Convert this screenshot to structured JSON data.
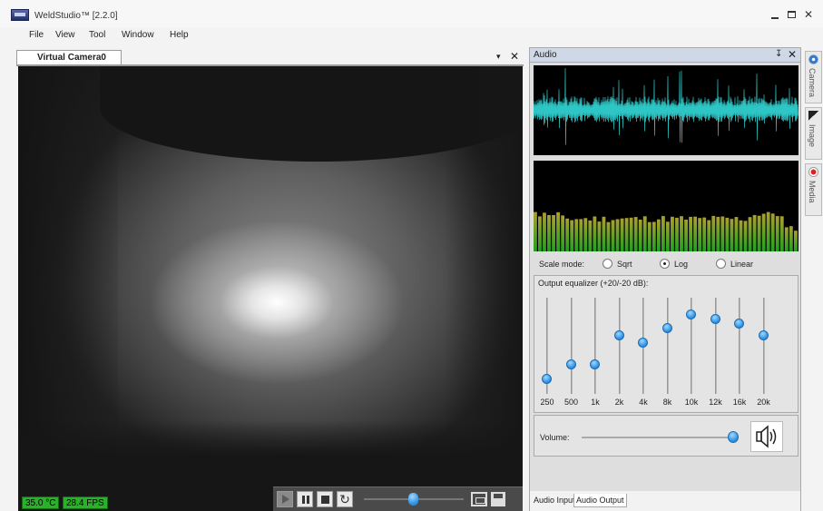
{
  "window": {
    "title": "WeldStudio™ [2.2.0]",
    "min_symbol": "",
    "max_symbol": "",
    "close_symbol": "✕"
  },
  "menu": [
    "File",
    "View",
    "Tool",
    "Window",
    "Help"
  ],
  "camera_tab": {
    "label": "Virtual Camera0",
    "dropdown_symbol": "▾",
    "close_symbol": "✕"
  },
  "video": {
    "temperature": "35.0 °C",
    "fps": "28.4 FPS"
  },
  "playback": {
    "loop_symbol": "↻",
    "scrub_position": 0.49
  },
  "audio": {
    "title": "Audio",
    "pin_symbol": "↧",
    "close_symbol": "✕",
    "waveform_color": "#2ec5c5",
    "spectrum_color_top": "#aaa030",
    "spectrum_color_bottom": "#20a020",
    "scale_mode": {
      "label": "Scale mode:",
      "options": [
        "Sqrt",
        "Log",
        "Linear"
      ],
      "selected": "Log"
    },
    "equalizer": {
      "title": "Output equalizer (+20/-20 dB):",
      "bands": [
        {
          "label": "250",
          "level": -14
        },
        {
          "label": "500",
          "level": -8
        },
        {
          "label": "1k",
          "level": -8
        },
        {
          "label": "2k",
          "level": 4
        },
        {
          "label": "4k",
          "level": 1
        },
        {
          "label": "8k",
          "level": 7
        },
        {
          "label": "10k",
          "level": 13
        },
        {
          "label": "12k",
          "level": 11
        },
        {
          "label": "16k",
          "level": 9
        },
        {
          "label": "20k",
          "level": 4
        }
      ]
    },
    "volume": {
      "label": "Volume:",
      "level": 0.97
    },
    "tabs": [
      "Audio Input",
      "Audio Output"
    ],
    "active_tab": "Audio Output"
  },
  "side_tabs": [
    {
      "label": "Camera",
      "icon": "camera-icon"
    },
    {
      "label": "Image",
      "icon": "image-icon"
    },
    {
      "label": "Media",
      "icon": "media-icon"
    }
  ]
}
